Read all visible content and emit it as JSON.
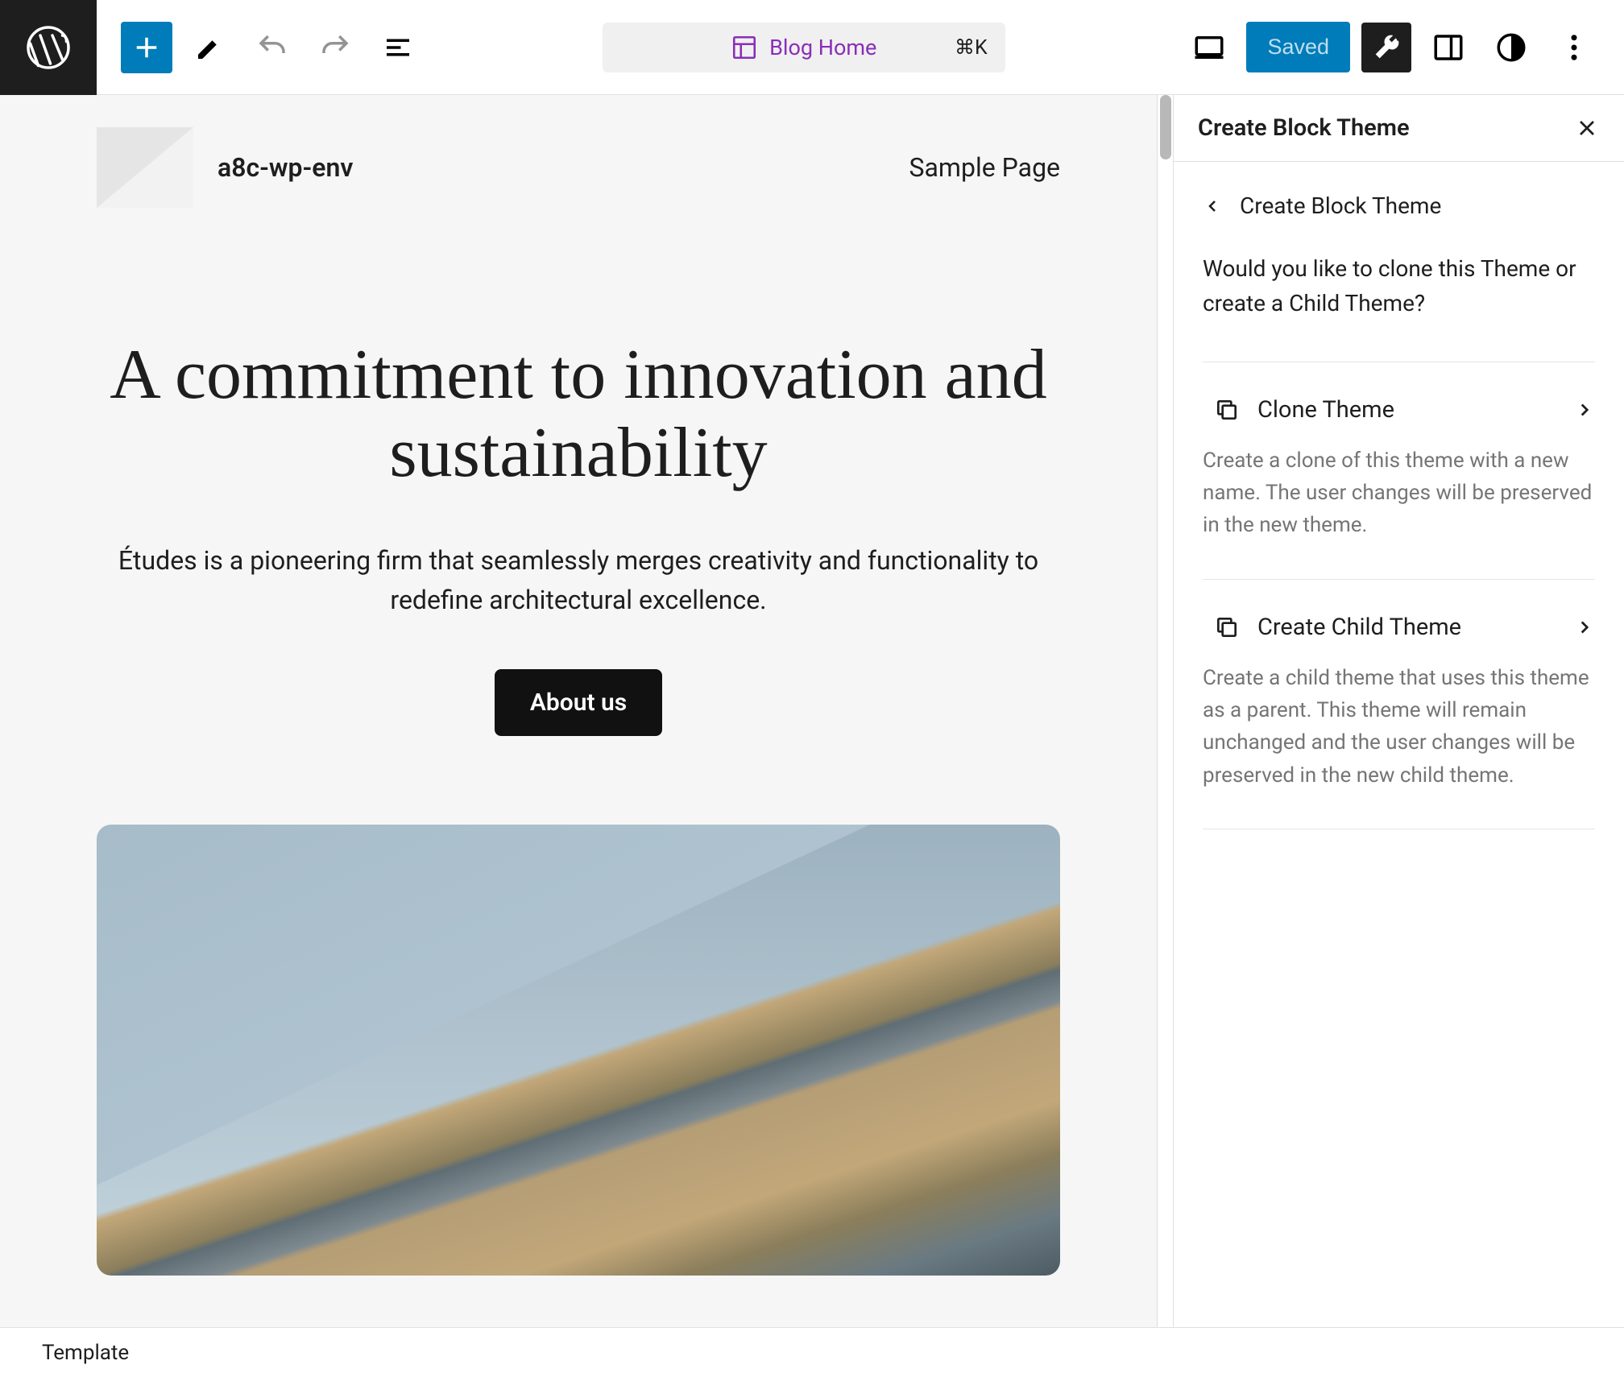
{
  "topbar": {
    "page_label": "Blog Home",
    "shortcut": "⌘K",
    "saved_label": "Saved"
  },
  "canvas": {
    "site_title": "a8c-wp-env",
    "nav_item": "Sample Page",
    "hero_title": "A commitment to innovation and sustainability",
    "hero_text": "Études is a pioneering firm that seamlessly merges creativity and functionality to redefine architectural excellence.",
    "about_label": "About us"
  },
  "sidebar": {
    "title": "Create Block Theme",
    "back_label": "Create Block Theme",
    "prompt": "Would you like to clone this Theme or create a Child Theme?",
    "options": [
      {
        "label": "Clone Theme",
        "desc": "Create a clone of this theme with a new name. The user changes will be preserved in the new theme."
      },
      {
        "label": "Create Child Theme",
        "desc": "Create a child theme that uses this theme as a parent. This theme will remain unchanged and the user changes will be preserved in the new child theme."
      }
    ]
  },
  "footer": {
    "label": "Template"
  }
}
